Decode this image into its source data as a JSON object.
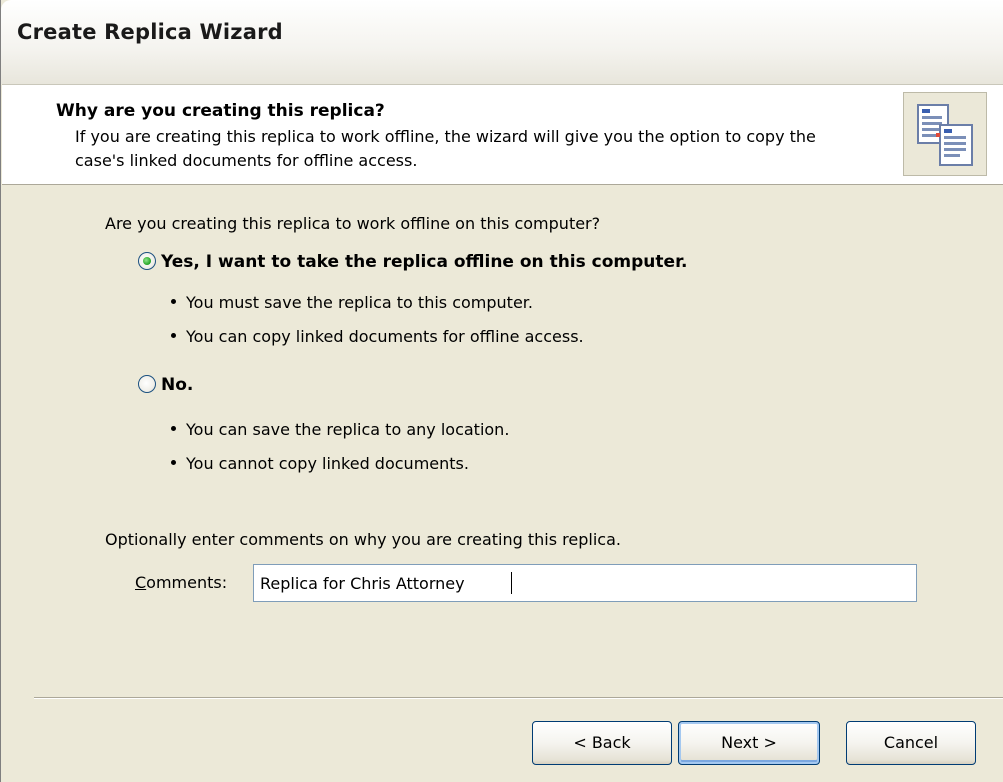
{
  "window": {
    "title": "Create Replica Wizard"
  },
  "header": {
    "title": "Why are you creating this replica?",
    "description": "If you are creating this replica to work offline, the wizard will give you the option to copy the case's linked documents for offline access.",
    "icon": "documents-icon"
  },
  "question": "Are you creating this replica to work offline on this computer?",
  "options": [
    {
      "label": "Yes, I want to take the replica offline on this computer.",
      "checked": true,
      "bullets": [
        "You must save the replica to this computer.",
        "You can copy linked documents for offline access."
      ]
    },
    {
      "label": "No.",
      "checked": false,
      "bullets": [
        "You can save the replica to any location.",
        "You cannot copy linked documents."
      ]
    }
  ],
  "comments": {
    "prompt": "Optionally enter comments on why you are creating this replica.",
    "label_mnemonic": "C",
    "label_rest": "omments:",
    "value": "Replica for Chris Attorney"
  },
  "buttons": {
    "back": "< Back",
    "next": "Next >",
    "cancel": "Cancel"
  },
  "colors": {
    "dialog_bg": "#ece9d8",
    "header_bg": "#ffffff",
    "radio_checked": "#21a121",
    "button_border": "#003c74"
  }
}
